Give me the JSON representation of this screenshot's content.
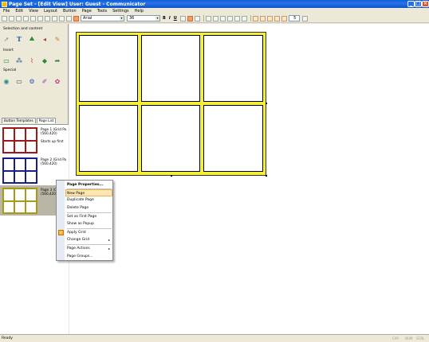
{
  "window": {
    "title": "Page Set - [Edit View]   User: Guest - Communicator",
    "controls": [
      "_",
      "□",
      "×"
    ]
  },
  "menu": [
    "File",
    "Edit",
    "View",
    "Layout",
    "Button",
    "Page",
    "Tools",
    "Settings",
    "Help"
  ],
  "toolbar": {
    "font_name": "Arial",
    "font_size": "36",
    "bold": "B",
    "italic": "I",
    "underline": "U",
    "zoom_value": "5"
  },
  "left_panel": {
    "selection_label": "Selection and content",
    "insert_label": "Insert",
    "special_label": "Special",
    "tabs": [
      "Button Templates",
      "Page List"
    ],
    "pages": [
      {
        "title": "Page 1 (Grid Pa",
        "size": "(560,420)",
        "note": "Starts up first",
        "color": "#a01818"
      },
      {
        "title": "Page 2 (Grid Pa",
        "size": "(560,420)",
        "note": "",
        "color": "#1a1e88"
      },
      {
        "title": "Page 3 (Grid Pa",
        "size": "(560,420)",
        "note": "",
        "color": "#a89a18"
      }
    ]
  },
  "context_menu": {
    "items": [
      "Page Properties...",
      "New Page",
      "Duplicate Page",
      "Delete Page",
      "Set as First Page",
      "Show as Popup",
      "Apply Grid",
      "Change Grid",
      "Page Actions",
      "Page Groups..."
    ]
  },
  "statusbar": {
    "text": "Ready",
    "indicators": [
      "CAP",
      "NUM",
      "SCRL"
    ]
  },
  "colors": {
    "page_background": "#f5ee3a",
    "page_border": "#333333"
  }
}
